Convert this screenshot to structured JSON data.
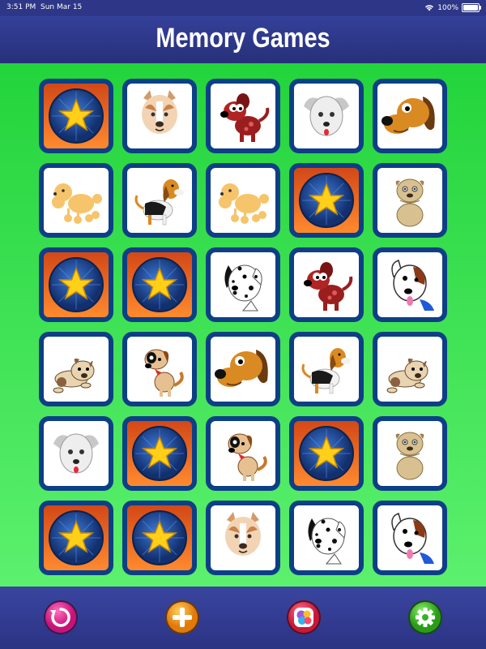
{
  "status_bar": {
    "time": "3:51 PM",
    "date": "Sun Mar 15",
    "battery": "100%",
    "wifi_icon": "wifi-icon",
    "battery_icon": "battery-icon"
  },
  "header": {
    "title": "Memory Games"
  },
  "board": {
    "rows": 6,
    "cols": 5,
    "cards": [
      [
        "star-back",
        "pitbull",
        "red-puppy",
        "white-puppy",
        "brown-hound"
      ],
      [
        "poodle",
        "beagle",
        "poodle",
        "star-back",
        "sitting-shar-pei"
      ],
      [
        "star-back",
        "star-back",
        "dalmatian",
        "red-puppy",
        "bull-terrier"
      ],
      [
        "lying-puppy",
        "spotted-pup",
        "brown-hound",
        "beagle",
        "lying-puppy"
      ],
      [
        "white-puppy",
        "star-back",
        "spotted-pup",
        "star-back",
        "sitting-shar-pei"
      ],
      [
        "star-back",
        "star-back",
        "pitbull",
        "dalmatian",
        "bull-terrier"
      ]
    ]
  },
  "toolbar": {
    "buttons": [
      {
        "icon": "restart-icon",
        "color": "#e8288e"
      },
      {
        "icon": "plus-icon",
        "color": "#f39a1c"
      },
      {
        "icon": "game-center-icon",
        "color": "#e0306a"
      },
      {
        "icon": "settings-icon",
        "color": "#3ec42a"
      }
    ]
  },
  "colors": {
    "header": "#2e3787",
    "board_top": "#23d43c",
    "board_bottom": "#5cf06e",
    "card_border": "#0d3f86",
    "card_back": "#e0561f"
  }
}
